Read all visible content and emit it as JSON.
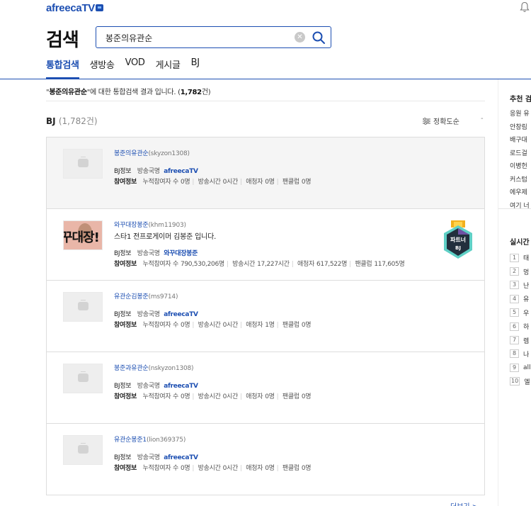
{
  "header": {
    "logo_text": "afreecaTV",
    "page_title": "검색",
    "search_value": "봉준의유관순"
  },
  "tabs": [
    {
      "label": "통합검색",
      "active": true
    },
    {
      "label": "생방송",
      "active": false
    },
    {
      "label": "VOD",
      "active": false
    },
    {
      "label": "게시글",
      "active": false
    },
    {
      "label": "BJ",
      "active": false
    }
  ],
  "summary": {
    "prefix": "\"",
    "query": "봉준의유관순",
    "middle": "\"에 대한 통합검색 결과 입니다. (",
    "count": "1,782",
    "suffix": "건)"
  },
  "bj_section": {
    "title": "BJ",
    "count": "(1,782건)",
    "sort_label": "정확도순",
    "sort_caret": "-",
    "labels": {
      "bj_info": "BJ정보",
      "station": "방송국명",
      "participation": "참여정보",
      "viewers_total": "누적참여자 수",
      "broadcast_time": "방송시간",
      "fans": "애청자",
      "fanclub": "팬클럽"
    },
    "cards": [
      {
        "nickname": "봉준의유관순",
        "bj_id": "(skyzon1308)",
        "description": "",
        "station": "afreecaTV",
        "viewers": "0명",
        "time": "0시간",
        "fans": "0명",
        "fanclub": "0명",
        "thumb": "placeholder",
        "partner": false
      },
      {
        "nickname": "와꾸대장봉준",
        "bj_id": "(khm11903)",
        "description": "스타1 전프로게이머 김봉준 입니다.",
        "station": "와꾸대장봉준",
        "viewers": "790,530,206명",
        "time": "17,227시간",
        "fans": "617,522명",
        "fanclub": "117,605명",
        "thumb": "photo",
        "thumb_text": "꾸대장!",
        "partner": true
      },
      {
        "nickname": "유관순김봉준",
        "bj_id": "(ms9714)",
        "description": "",
        "station": "afreecaTV",
        "viewers": "0명",
        "time": "0시간",
        "fans": "1명",
        "fanclub": "0명",
        "thumb": "placeholder",
        "partner": false
      },
      {
        "nickname": "봉준과유관순",
        "bj_id": "(nskyzon1308)",
        "description": "",
        "station": "afreecaTV",
        "viewers": "0명",
        "time": "0시간",
        "fans": "0명",
        "fanclub": "0명",
        "thumb": "placeholder",
        "partner": false
      },
      {
        "nickname": "유관순봉준1",
        "bj_id": "(lion369375)",
        "description": "",
        "station": "afreecaTV",
        "viewers": "0명",
        "time": "0시간",
        "fans": "0명",
        "fanclub": "0명",
        "thumb": "placeholder",
        "partner": false
      }
    ],
    "partner_badge": {
      "line1": "파트너",
      "line2": "BJ"
    },
    "more_link": "더보기 >"
  },
  "right_panel": {
    "recommend_title": "추천 검",
    "recommend_items": [
      "응원 유",
      "안창림",
      "배구대",
      "로드걸",
      "이병헌",
      "커스텀",
      "에우제",
      "여기 너"
    ],
    "realtime_title": "실시간",
    "realtime_items": [
      {
        "rank": "1",
        "text": "태"
      },
      {
        "rank": "2",
        "text": "멍"
      },
      {
        "rank": "3",
        "text": "난"
      },
      {
        "rank": "4",
        "text": "유"
      },
      {
        "rank": "5",
        "text": "우"
      },
      {
        "rank": "6",
        "text": "하"
      },
      {
        "rank": "7",
        "text": "렘"
      },
      {
        "rank": "8",
        "text": "나"
      },
      {
        "rank": "9",
        "text": "all"
      },
      {
        "rank": "10",
        "text": "엘"
      }
    ]
  },
  "colors": {
    "accent": "#1d4fb2",
    "divider": "#dddddd",
    "selected_card_bg": "#f5f5f5"
  },
  "icons": [
    "bell-icon",
    "clear-icon",
    "search-icon",
    "sort-icon",
    "tv-placeholder-icon",
    "partner-bj-badge-icon"
  ]
}
